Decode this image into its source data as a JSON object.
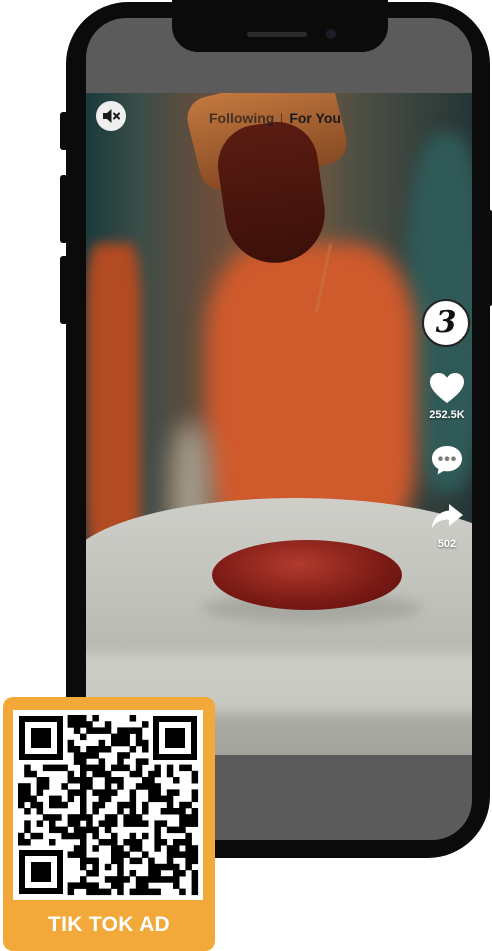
{
  "feed_tabs": {
    "following": "Following",
    "for_you": "For You"
  },
  "controls": {
    "mute_icon": "speaker-muted-icon"
  },
  "creator": {
    "avatar_glyph": "3"
  },
  "actions": {
    "like": {
      "icon": "heart-icon",
      "count": "252.5K"
    },
    "comment": {
      "icon": "comment-bubble-icon",
      "count": ""
    },
    "share": {
      "icon": "share-arrow-icon",
      "count": "502"
    }
  },
  "qr_card": {
    "label": "TIK TOK AD"
  },
  "colors": {
    "card_accent": "#f3a83a",
    "phone_frame": "#0b0b0b",
    "screen_bezel": "#5b5b5b"
  }
}
